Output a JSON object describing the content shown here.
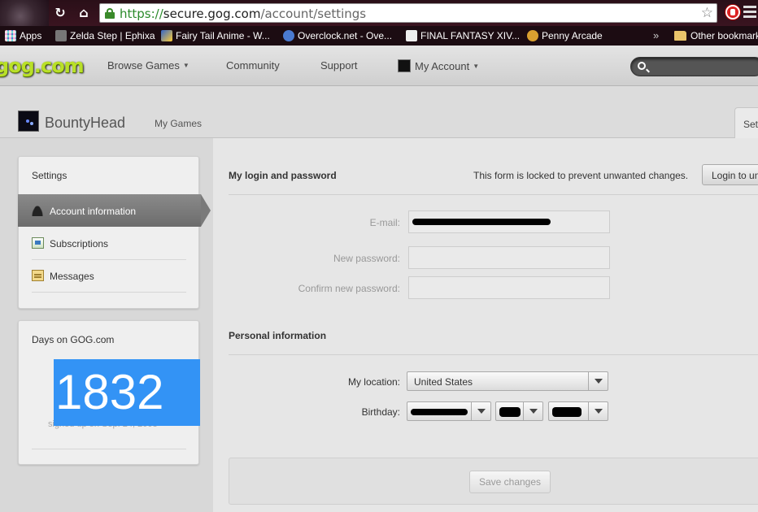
{
  "browser": {
    "url_scheme": "https://",
    "url_host": "secure.gog.com",
    "url_path": "/account/settings",
    "bookmarks": [
      {
        "label": "Apps"
      },
      {
        "label": "Zelda Step | Ephixa"
      },
      {
        "label": "Fairy Tail Anime - W..."
      },
      {
        "label": "Overclock.net - Ove..."
      },
      {
        "label": "FINAL FANTASY XIV..."
      },
      {
        "label": "Penny Arcade"
      }
    ],
    "more_bookmarks": "»",
    "other_bookmarks": "Other bookmarks"
  },
  "gog_nav": {
    "logo": "gog.com",
    "items": [
      {
        "label": "Browse Games"
      },
      {
        "label": "Community"
      },
      {
        "label": "Support"
      },
      {
        "label": "My Account"
      }
    ]
  },
  "profile": {
    "username": "BountyHead",
    "my_games": "My Games",
    "settings_tab": "Settings"
  },
  "sidebar": {
    "title": "Settings",
    "items": [
      {
        "label": "Account information",
        "active": true
      },
      {
        "label": "Subscriptions"
      },
      {
        "label": "Messages"
      }
    ],
    "days_title": "Days on GOG.com",
    "days_count": "1832",
    "signed_up": "signed up on Sep. 24, 2008"
  },
  "login_section": {
    "title": "My login and password",
    "locked_note": "This form is locked to prevent unwanted changes.",
    "login_button": "Login to unlock",
    "email_label": "E-mail:",
    "new_password_label": "New password:",
    "confirm_password_label": "Confirm new password:"
  },
  "personal_section": {
    "title": "Personal information",
    "location_label": "My location:",
    "location_value": "United States",
    "birthday_label": "Birthday:"
  },
  "save_button": "Save changes",
  "colors": {
    "days_highlight": "#3393f5",
    "logo_green": "#b9e028",
    "browser_frame": "#2a0f18"
  }
}
